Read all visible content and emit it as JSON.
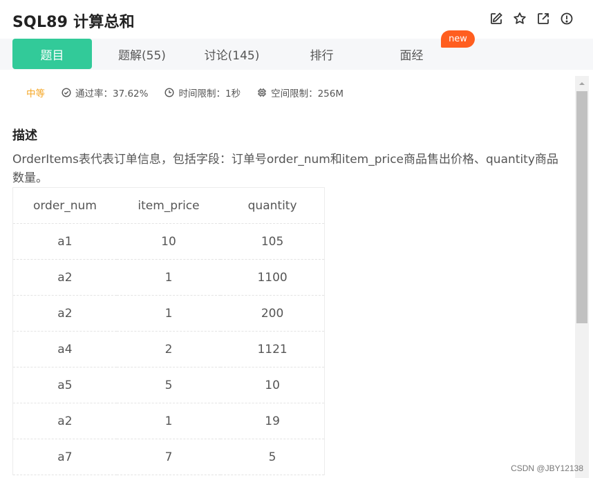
{
  "header": {
    "title": "SQL89  计算总和",
    "icons": [
      "edit-icon",
      "star-icon",
      "external-link-icon",
      "info-icon"
    ]
  },
  "tabs": [
    {
      "label": "题目",
      "active": true
    },
    {
      "label": "题解(55)",
      "active": false
    },
    {
      "label": "讨论(145)",
      "active": false
    },
    {
      "label": "排行",
      "active": false
    },
    {
      "label": "面经",
      "active": false
    }
  ],
  "badge": {
    "new_label": "new"
  },
  "meta": {
    "difficulty": "中等",
    "pass_rate": "通过率：37.62%",
    "time_limit": "时间限制：1秒",
    "memory_limit": "空间限制：256M"
  },
  "description": {
    "title": "描述",
    "text": "OrderItems表代表订单信息，包括字段：订单号order_num和item_price商品售出价格、quantity商品数量。"
  },
  "table": {
    "headers": [
      "order_num",
      "item_price",
      "quantity"
    ],
    "rows": [
      [
        "a1",
        "10",
        "105"
      ],
      [
        "a2",
        "1",
        "1100"
      ],
      [
        "a2",
        "1",
        "200"
      ],
      [
        "a4",
        "2",
        "1121"
      ],
      [
        "a5",
        "5",
        "10"
      ],
      [
        "a2",
        "1",
        "19"
      ],
      [
        "a7",
        "7",
        "5"
      ]
    ]
  },
  "watermark": "CSDN @JBY12138",
  "colors": {
    "accent": "#32ca99",
    "badge": "#ff5e1f",
    "difficulty": "#f5a623"
  }
}
